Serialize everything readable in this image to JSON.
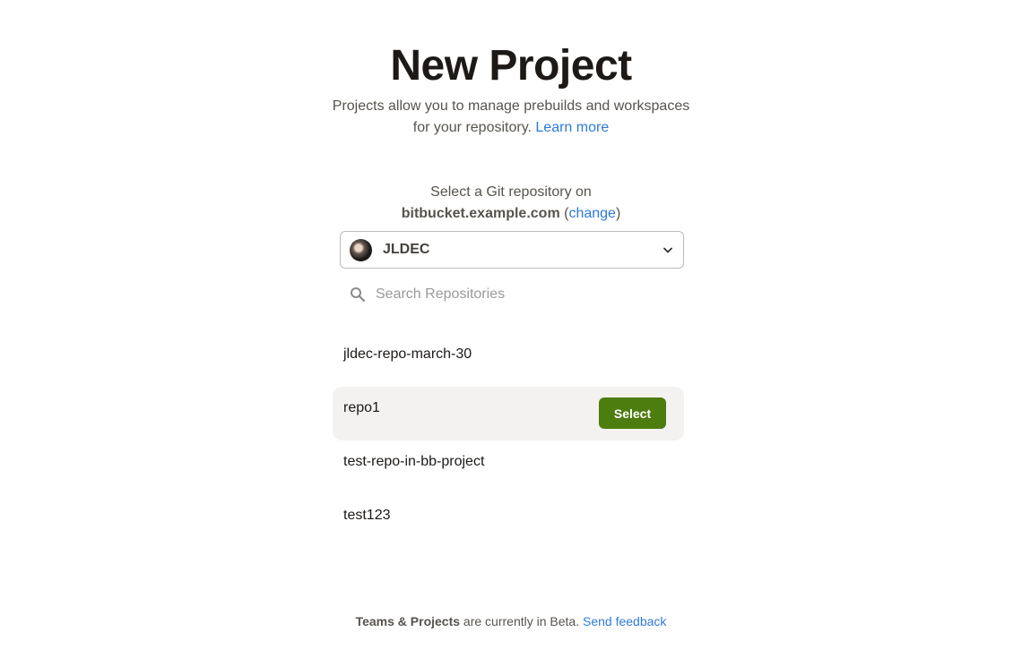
{
  "header": {
    "title": "New Project",
    "subtitle": "Projects allow you to manage prebuilds and workspaces for your repository.",
    "learn_more": "Learn more"
  },
  "provider": {
    "prompt": "Select a Git repository on",
    "host": "bitbucket.example.com",
    "open_paren": " (",
    "change_link": "change",
    "close_paren": ")"
  },
  "account": {
    "name": "JLDEC",
    "avatar_icon": "user-avatar",
    "dropdown_icon": "chevron-down-icon"
  },
  "search": {
    "placeholder": "Search Repositories",
    "value": "",
    "icon": "search-icon"
  },
  "repositories": [
    {
      "name": "jldec-repo-march-30"
    },
    {
      "name": "repo1"
    },
    {
      "name": "test-repo-in-bb-project"
    },
    {
      "name": "test123"
    }
  ],
  "hovered_repo_index": 1,
  "select_button_label": "Select",
  "footer": {
    "feature": "Teams & Projects",
    "text": " are currently in Beta. ",
    "feedback_link": "Send feedback"
  },
  "colors": {
    "accent_link": "#2e7bd8",
    "select_button": "#4d7c0f",
    "hover_row": "#f3f2f1"
  }
}
